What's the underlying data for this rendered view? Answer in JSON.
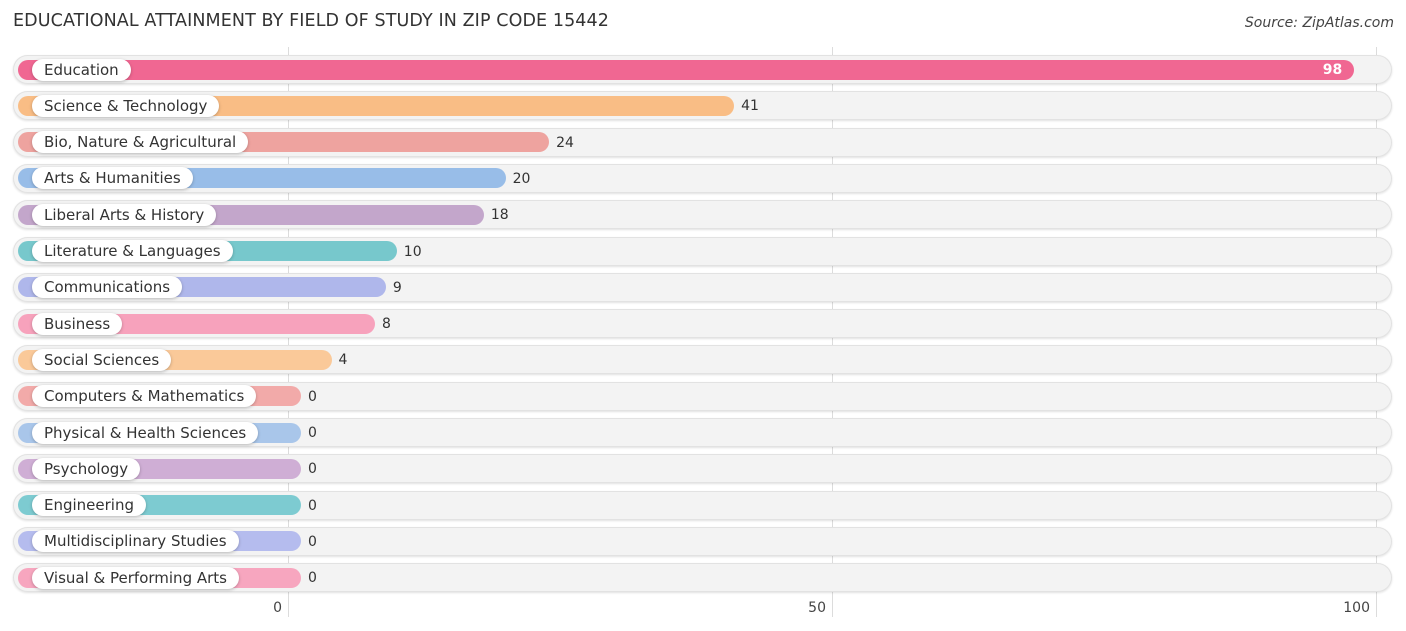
{
  "header": {
    "title": "EDUCATIONAL ATTAINMENT BY FIELD OF STUDY IN ZIP CODE 15442",
    "source": "Source: ZipAtlas.com"
  },
  "chart_data": {
    "type": "bar",
    "orientation": "horizontal",
    "title": "EDUCATIONAL ATTAINMENT BY FIELD OF STUDY IN ZIP CODE 15442",
    "xlabel": "",
    "ylabel": "",
    "xlim": [
      0,
      100
    ],
    "xticks": [
      "0",
      "50",
      "100"
    ],
    "grid": true,
    "categories": [
      "Education",
      "Science & Technology",
      "Bio, Nature & Agricultural",
      "Arts & Humanities",
      "Liberal Arts & History",
      "Literature & Languages",
      "Communications",
      "Business",
      "Social Sciences",
      "Computers & Mathematics",
      "Physical & Health Sciences",
      "Psychology",
      "Engineering",
      "Multidisciplinary Studies",
      "Visual & Performing Arts"
    ],
    "values": [
      98,
      41,
      24,
      20,
      18,
      10,
      9,
      8,
      4,
      0,
      0,
      0,
      0,
      0,
      0
    ],
    "colors": [
      "#f06792",
      "#f9bd85",
      "#eea39f",
      "#98bde8",
      "#c3a6cb",
      "#77c8cc",
      "#afb7eb",
      "#f7a2bc",
      "#fac999",
      "#f2aaa9",
      "#a9c6ea",
      "#cfaed5",
      "#7dcbd1",
      "#b5bcee",
      "#f7a6bf"
    ]
  }
}
